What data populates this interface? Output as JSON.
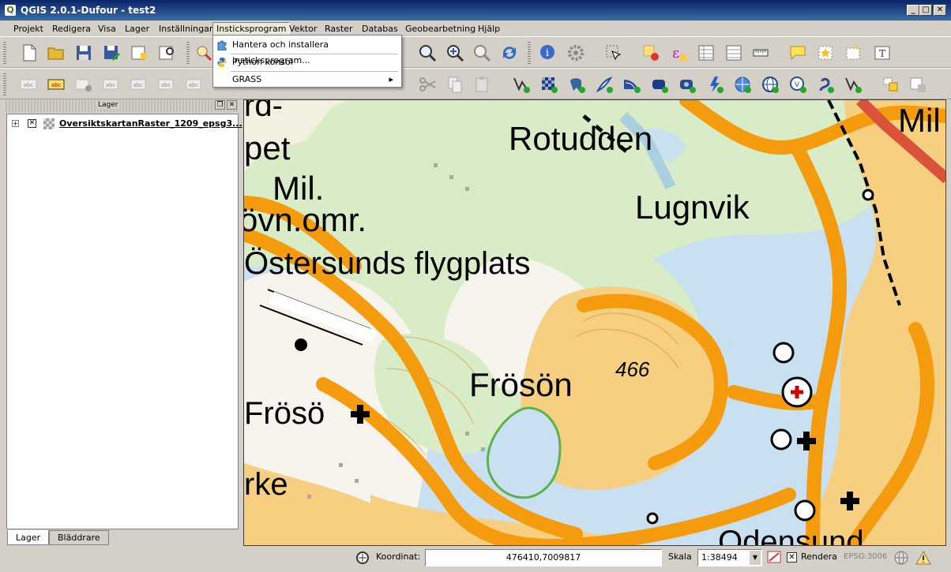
{
  "window": {
    "title": "QGIS 2.0.1-Dufour - test2",
    "app_icon": "Q",
    "controls": {
      "minimize": "_",
      "maximize": "□",
      "close": "✕"
    }
  },
  "menubar": {
    "items": [
      "Projekt",
      "Redigera",
      "Visa",
      "Lager",
      "Inställningar",
      "Insticksprogram",
      "Vektor",
      "Raster",
      "Databas",
      "Geobearbetning",
      "Hjälp"
    ],
    "active": "Insticksprogram"
  },
  "plugins_menu": {
    "items": [
      {
        "label": "Hantera och installera insticksprogram...",
        "icon": "plugin-puzzle-icon"
      },
      {
        "label": "Python konsol",
        "icon": "python-icon"
      },
      {
        "label": "GRASS",
        "icon": "",
        "submenu_arrow": "▸"
      }
    ]
  },
  "layers_panel": {
    "title": "Lager",
    "float_button": "❐",
    "close_button": "✕",
    "layer": {
      "expander": "+",
      "checked": "✕",
      "name": "OversiktskartanRaster_1209_epsg3..."
    },
    "tabs": [
      "Lager",
      "Bläddrare"
    ],
    "active_tab": "Lager"
  },
  "map": {
    "labels": [
      "Mil",
      "Rotudden",
      "Lugnvik",
      "Mil.",
      "övn.omr.",
      "Östersunds flygplats",
      "Frösön",
      "466",
      "Frösö",
      "Odensund",
      "pet",
      "rke",
      "rd-"
    ]
  },
  "statusbar": {
    "coord_label": "Koordinat:",
    "coord_value": "476410,7009817",
    "scale_label": "Skala",
    "scale_value": "1:38494",
    "render_label": "Rendera",
    "render_checked": "✕",
    "crs": "EPSG:3006"
  }
}
